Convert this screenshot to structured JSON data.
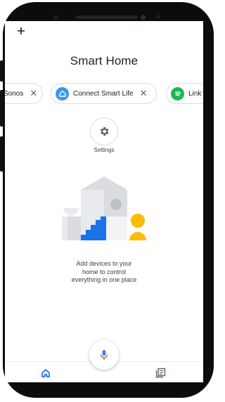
{
  "header": {
    "title": "Smart Home",
    "add_icon": "plus-icon"
  },
  "chips": [
    {
      "label": "Sonos",
      "icon": null,
      "close_icon": "close-icon"
    },
    {
      "label": "Connect Smart Life",
      "icon": "smart-life-home-icon",
      "icon_color": "#3a95f2",
      "close_icon": "close-icon"
    },
    {
      "label": "Link",
      "icon": "spotify-icon",
      "icon_color": "#1db954"
    }
  ],
  "settings": {
    "label": "Settings",
    "icon": "gear-icon"
  },
  "empty_state": {
    "lines": [
      "Add devices to your",
      "home to control",
      "everything in one place"
    ]
  },
  "mic": {
    "icon": "microphone-icon"
  },
  "bottom_nav": {
    "home_icon": "home-icon",
    "feed_icon": "feed-icon",
    "accent": "#1a73e8"
  }
}
